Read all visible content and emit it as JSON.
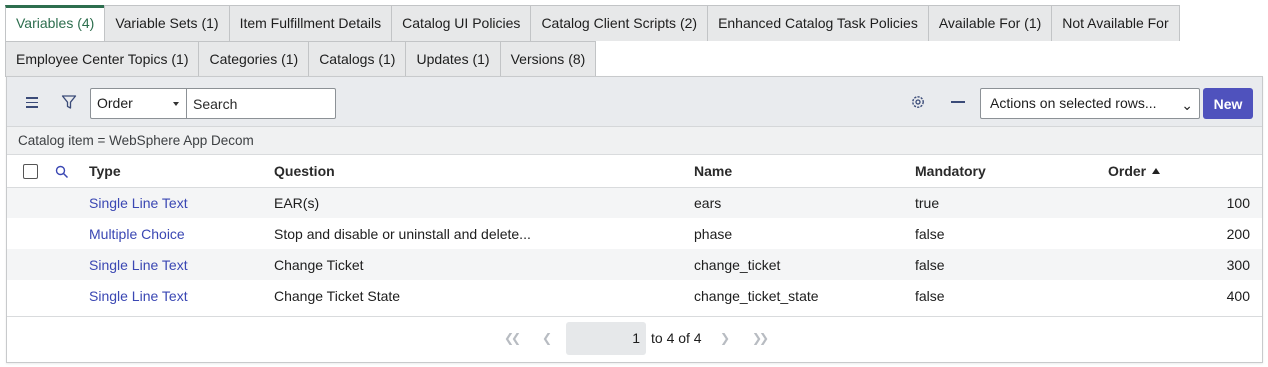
{
  "tabs": {
    "row1": [
      "Variables (4)",
      "Variable Sets (1)",
      "Item Fulfillment Details",
      "Catalog UI Policies",
      "Catalog Client Scripts (2)",
      "Enhanced Catalog Task Policies",
      "Available For (1)",
      "Not Available For"
    ],
    "row2": [
      "Employee Center Topics (1)",
      "Categories (1)",
      "Catalogs (1)",
      "Updates (1)",
      "Versions (8)"
    ],
    "active": "Variables (4)"
  },
  "toolbar": {
    "order_select": "Order",
    "search_placeholder": "Search",
    "actions_select": "Actions on selected rows...",
    "new_label": "New"
  },
  "breadcrumb": "Catalog item = WebSphere App Decom",
  "table": {
    "columns": [
      "Type",
      "Question",
      "Name",
      "Mandatory",
      "Order"
    ],
    "sorted_column": "Order",
    "sort_direction": "ascending",
    "rows": [
      {
        "type": "Single Line Text",
        "question": "EAR(s)",
        "name": "ears",
        "mandatory": "true",
        "order": "100"
      },
      {
        "type": "Multiple Choice",
        "question": "Stop and disable or uninstall and delete...",
        "name": "phase",
        "mandatory": "false",
        "order": "200"
      },
      {
        "type": "Single Line Text",
        "question": "Change Ticket",
        "name": "change_ticket",
        "mandatory": "false",
        "order": "300"
      },
      {
        "type": "Single Line Text",
        "question": "Change Ticket State",
        "name": "change_ticket_state",
        "mandatory": "false",
        "order": "400"
      }
    ]
  },
  "pagination": {
    "current": "1",
    "range_text": "to 4 of 4"
  },
  "colors": {
    "accent_green": "#2d6e4e",
    "link_blue": "#3a47b3",
    "primary_button": "#4f52bd"
  }
}
